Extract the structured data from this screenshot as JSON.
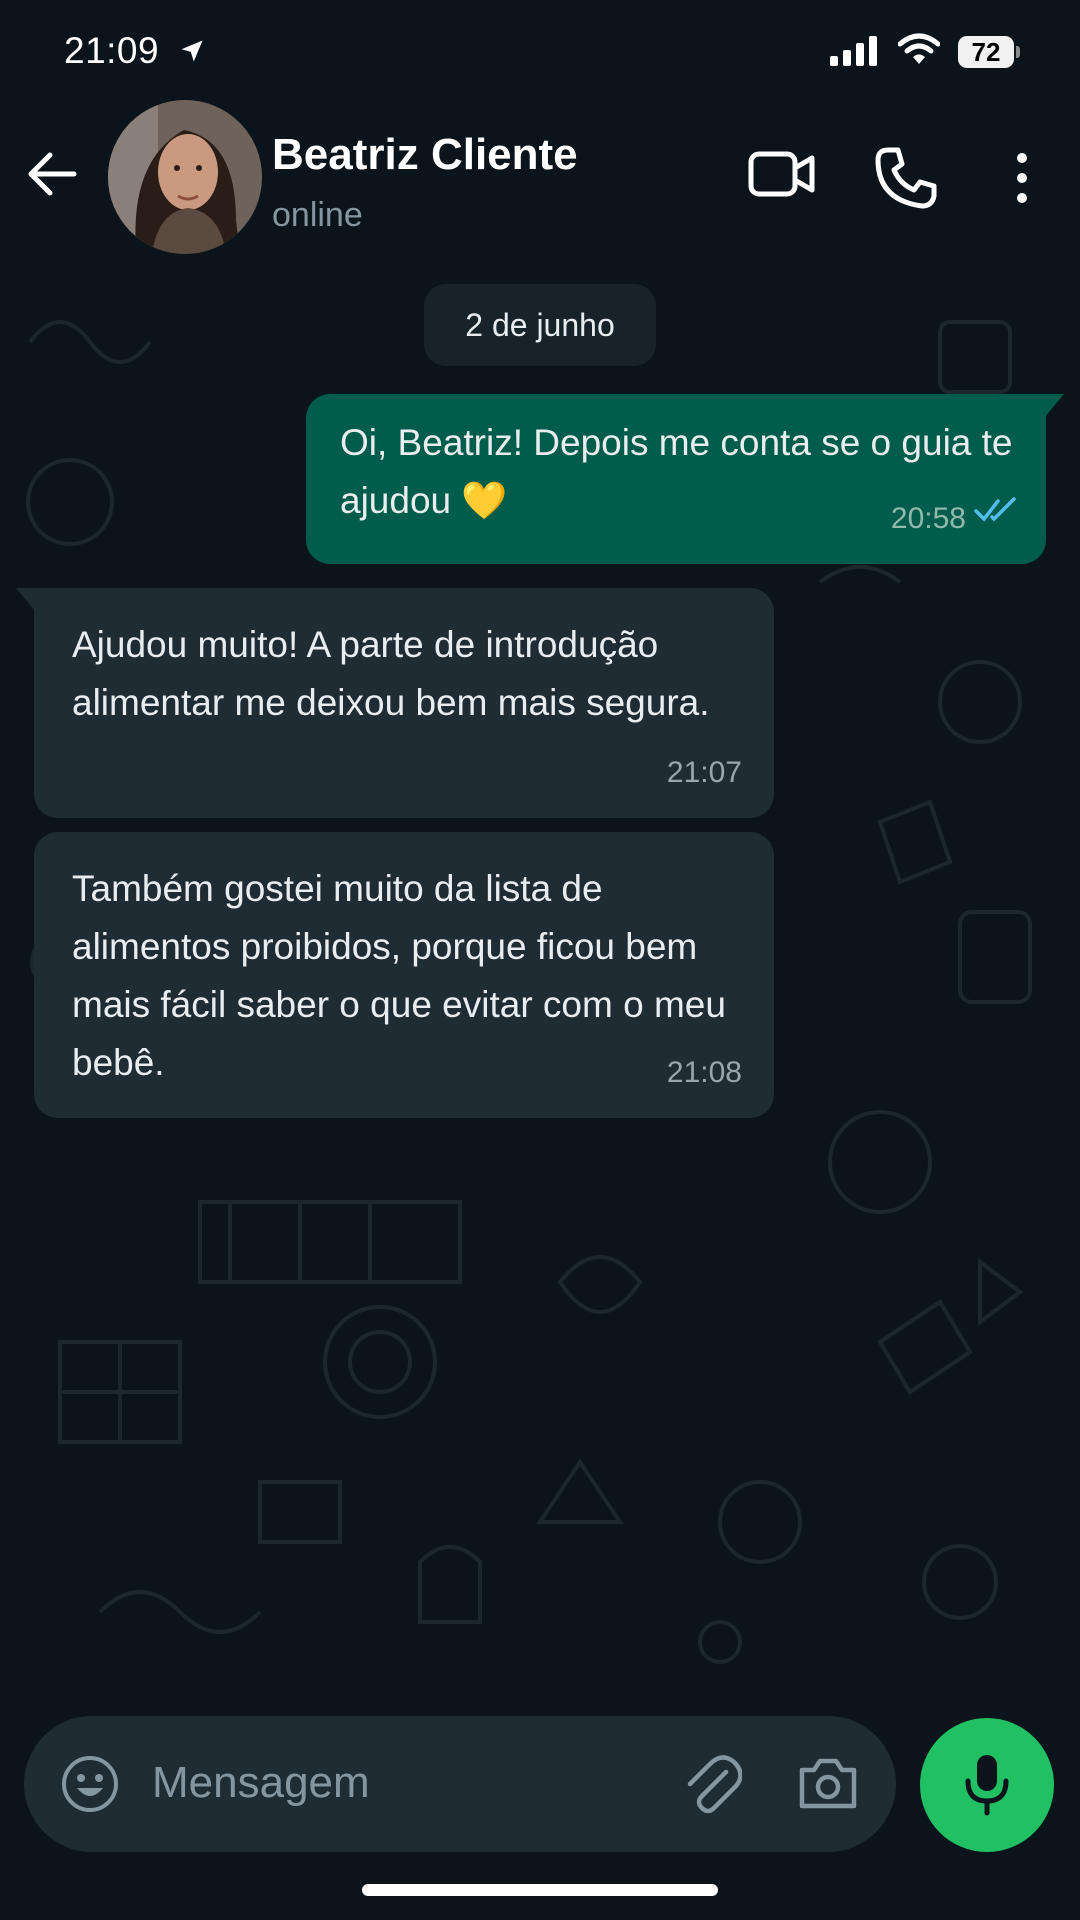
{
  "status_bar": {
    "time": "21:09",
    "battery": "72",
    "icons": [
      "location-arrow-icon",
      "signal-icon",
      "wifi-icon",
      "battery-icon"
    ]
  },
  "header": {
    "contact_name": "Beatriz Cliente",
    "contact_status": "online",
    "icons": [
      "back-arrow-icon",
      "video-call-icon",
      "phone-call-icon",
      "more-vertical-icon"
    ]
  },
  "chat": {
    "date_chip": "2 de junho",
    "messages": [
      {
        "direction": "outgoing",
        "text": "Oi, Beatriz! Depois me conta se o guia te ajudou 💛",
        "time": "20:58",
        "read": true
      },
      {
        "direction": "incoming",
        "text": "Ajudou muito! A parte de introdução alimentar me deixou bem mais segura.",
        "time": "21:07"
      },
      {
        "direction": "incoming",
        "text": "Também gostei muito da lista de alimentos proibidos, porque ficou bem mais fácil saber o que evitar com o meu bebê.",
        "time": "21:08"
      }
    ]
  },
  "composer": {
    "placeholder": "Mensagem",
    "icons": [
      "emoji-icon",
      "attach-icon",
      "camera-icon",
      "mic-icon"
    ]
  },
  "colors": {
    "background": "#0b141a",
    "outgoing_bubble": "#005c4b",
    "incoming_bubble": "#202c33",
    "accent": "#21c063",
    "read_ticks": "#53bdeb"
  }
}
